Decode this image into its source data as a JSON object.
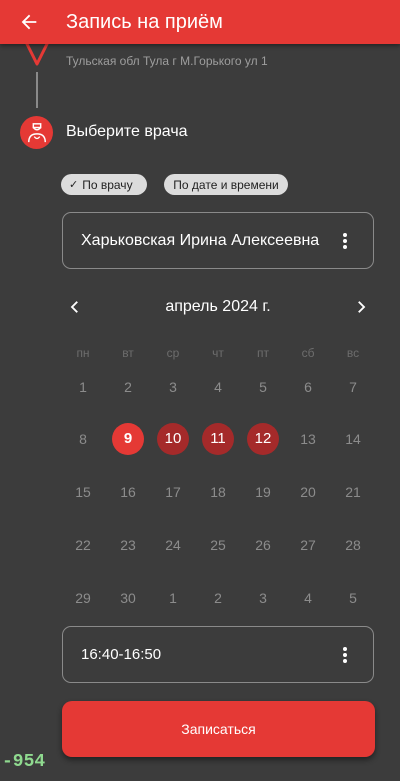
{
  "appbar": {
    "title": "Запись на приём",
    "back_icon": "arrow-left-icon"
  },
  "step_clinic": {
    "address": "Тульская обл Тула г М.Горького ул 1"
  },
  "step_doctor": {
    "label": "Выберите врача"
  },
  "filters": {
    "by_doctor": "По врачу",
    "by_datetime": "По дате и времени",
    "selected": "by_doctor"
  },
  "doctor_select": {
    "value": "Харьковская Ирина Алексеевна"
  },
  "calendar": {
    "month_label": "апрель 2024 г.",
    "weekdays": [
      "пн",
      "вт",
      "ср",
      "чт",
      "пт",
      "сб",
      "вс"
    ],
    "weeks": [
      [
        "1",
        "2",
        "3",
        "4",
        "5",
        "6",
        "7"
      ],
      [
        "8",
        "9",
        "10",
        "11",
        "12",
        "13",
        "14"
      ],
      [
        "15",
        "16",
        "17",
        "18",
        "19",
        "20",
        "21"
      ],
      [
        "22",
        "23",
        "24",
        "25",
        "26",
        "27",
        "28"
      ],
      [
        "29",
        "30",
        "1",
        "2",
        "3",
        "4",
        "5"
      ]
    ],
    "available_days": [
      "9",
      "10",
      "11",
      "12"
    ],
    "selected_day": "9"
  },
  "time_select": {
    "value": "16:40-16:50"
  },
  "submit": {
    "label": "Записаться"
  },
  "overlay": {
    "text": "-954"
  },
  "colors": {
    "accent": "#e53935",
    "available": "#a52a2a",
    "background": "#3c3c3c"
  }
}
